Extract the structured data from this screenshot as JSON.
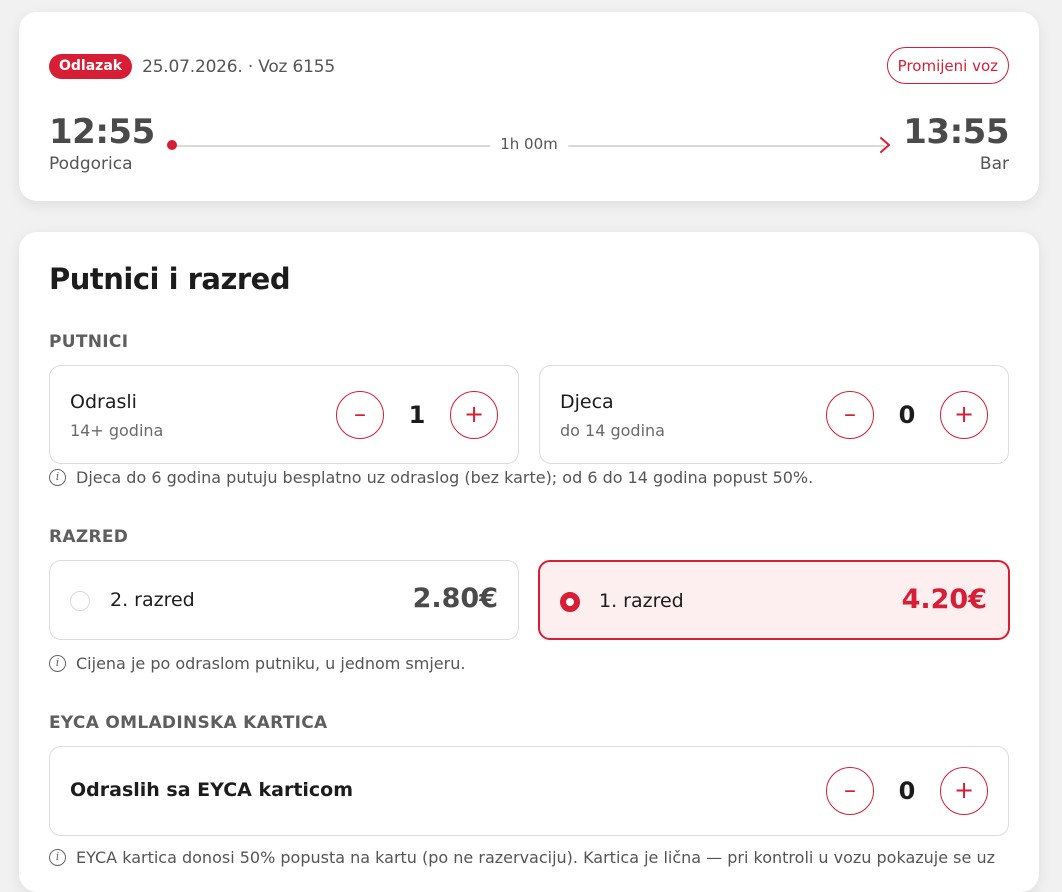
{
  "trip": {
    "badge": "Odlazak",
    "meta": "25.07.2026. · Voz 6155",
    "change_label": "Promijeni voz",
    "departure_time": "12:55",
    "departure_station": "Podgorica",
    "arrival_time": "13:55",
    "arrival_station": "Bar",
    "duration": "1h 00m"
  },
  "section_title": "Putnici i razred",
  "passengers": {
    "label": "PUTNICI",
    "adults": {
      "name": "Odrasli",
      "sub": "14+ godina",
      "count": "1",
      "minus": "–",
      "plus": "+"
    },
    "children": {
      "name": "Djeca",
      "sub": "do 14 godina",
      "count": "0",
      "minus": "–",
      "plus": "+"
    },
    "note": "Djeca do 6 godina putuju besplatno uz odraslog (bez karte); od 6 do 14 godina popust 50%."
  },
  "class": {
    "label": "RAZRED",
    "second": {
      "name": "2. razred",
      "price": "2.80€",
      "selected": false
    },
    "first": {
      "name": "1. razred",
      "price": "4.20€",
      "selected": true
    },
    "note": "Cijena je po odraslom putniku, u jednom smjeru."
  },
  "eyca": {
    "label": "EYCA OMLADINSKA KARTICA",
    "name": "Odraslih sa EYCA karticom",
    "count": "0",
    "minus": "–",
    "plus": "+",
    "note": "EYCA kartica donosi 50% popusta na kartu (po ne razervaciju). Kartica je lična — pri kontroli u vozu pokazuje se uz"
  },
  "icons": {
    "info": "info-icon",
    "arrow": "arrow-right-icon"
  },
  "colors": {
    "accent": "#d71e34",
    "selected_bg": "#fdeff0"
  }
}
